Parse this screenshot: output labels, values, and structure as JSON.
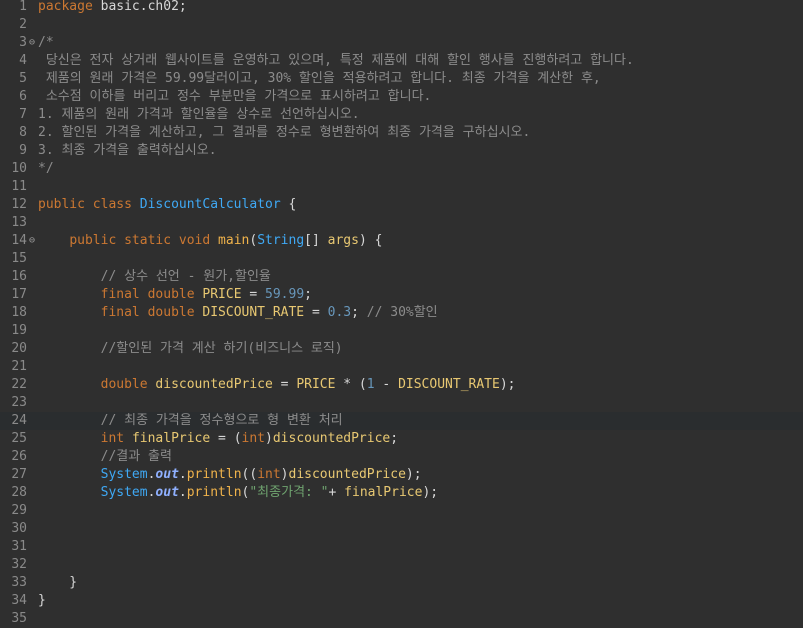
{
  "editor": {
    "lines": [
      {
        "n": "1",
        "t": "package basic.ch02;"
      },
      {
        "n": "2",
        "t": ""
      },
      {
        "n": "3",
        "fold": "⊖",
        "t": "/*"
      },
      {
        "n": "4",
        "t": " 당신은 전자 상거래 웹사이트를 운영하고 있으며, 특정 제품에 대해 할인 행사를 진행하려고 합니다."
      },
      {
        "n": "5",
        "t": " 제품의 원래 가격은 59.99달러이고, 30% 할인을 적용하려고 합니다. 최종 가격을 계산한 후,"
      },
      {
        "n": "6",
        "t": " 소수점 이하를 버리고 정수 부분만을 가격으로 표시하려고 합니다."
      },
      {
        "n": "7",
        "t": "1. 제품의 원래 가격과 할인율을 상수로 선언하십시오."
      },
      {
        "n": "8",
        "t": "2. 할인된 가격을 계산하고, 그 결과를 정수로 형변환하여 최종 가격을 구하십시오."
      },
      {
        "n": "9",
        "t": "3. 최종 가격을 출력하십시오."
      },
      {
        "n": "10",
        "t": "*/"
      },
      {
        "n": "11",
        "t": ""
      },
      {
        "n": "12",
        "t": "public class DiscountCalculator {"
      },
      {
        "n": "13",
        "t": ""
      },
      {
        "n": "14",
        "fold": "⊖",
        "t": "    public static void main(String[] args) {"
      },
      {
        "n": "15",
        "t": ""
      },
      {
        "n": "16",
        "t": "        // 상수 선언 - 원가,할인율"
      },
      {
        "n": "17",
        "t": "        final double PRICE = 59.99;"
      },
      {
        "n": "18",
        "t": "        final double DISCOUNT_RATE = 0.3; // 30%할인"
      },
      {
        "n": "19",
        "t": ""
      },
      {
        "n": "20",
        "t": "        //할인된 가격 계산 하기(비즈니스 로직)"
      },
      {
        "n": "21",
        "t": ""
      },
      {
        "n": "22",
        "t": "        double discountedPrice = PRICE * (1 - DISCOUNT_RATE);"
      },
      {
        "n": "23",
        "t": ""
      },
      {
        "n": "24",
        "t": "        // 최종 가격을 정수형으로 형 변환 처리"
      },
      {
        "n": "25",
        "t": "        int finalPrice = (int)discountedPrice;"
      },
      {
        "n": "26",
        "t": "        //결과 출력"
      },
      {
        "n": "27",
        "t": "        System.out.println((int)discountedPrice);"
      },
      {
        "n": "28",
        "t": "        System.out.println(\"최종가격: \"+ finalPrice);"
      },
      {
        "n": "29",
        "t": ""
      },
      {
        "n": "30",
        "t": ""
      },
      {
        "n": "31",
        "t": ""
      },
      {
        "n": "32",
        "t": ""
      },
      {
        "n": "33",
        "t": "    }"
      },
      {
        "n": "34",
        "t": "}"
      },
      {
        "n": "35",
        "t": ""
      }
    ],
    "current_line": "24"
  }
}
